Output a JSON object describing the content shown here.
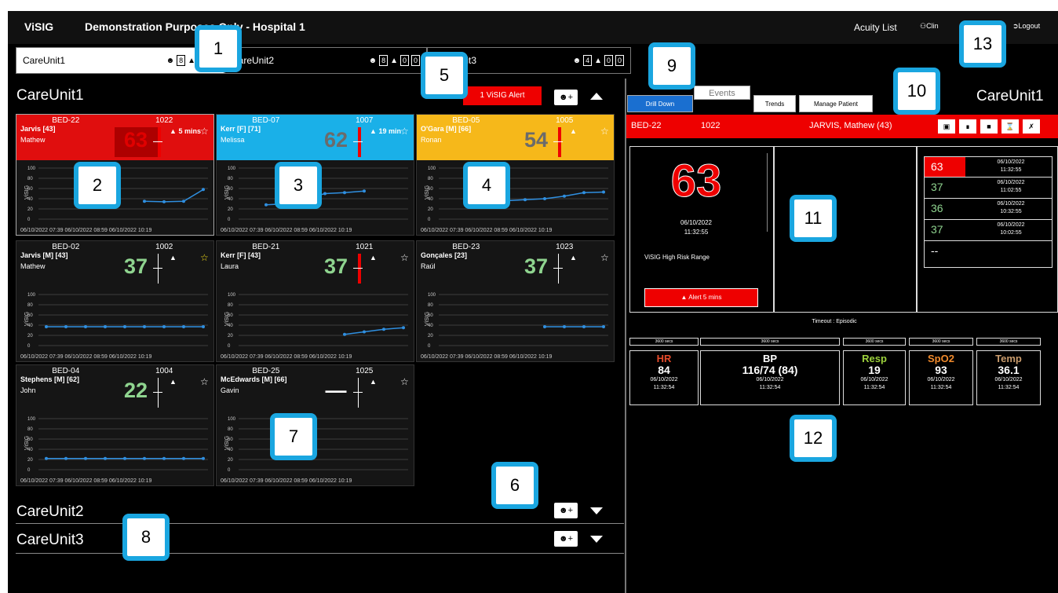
{
  "topbar": {
    "brand": "ViSIG",
    "title": "Demonstration Purposes Only - Hospital 1",
    "acuity_list": "Acuity List",
    "clinician": "Clin",
    "logout": "Logout"
  },
  "unit_tabs": [
    {
      "name": "CareUnit1",
      "patients": "8",
      "alerts": "1",
      "extra": "1"
    },
    {
      "name": "CareUnit2",
      "patients": "8",
      "alerts": "0",
      "extra": "0"
    },
    {
      "name": "CareUnit3",
      "patients": "4",
      "alerts": "0",
      "extra": "0"
    }
  ],
  "unit1": {
    "title": "CareUnit1",
    "alert_button": "1 ViSIG Alert"
  },
  "unit2": {
    "title": "CareUnit2"
  },
  "unit3": {
    "title": "CareUnit3"
  },
  "beds": [
    {
      "bed": "BED-22",
      "num": "1022",
      "name": "Jarvis [43]",
      "first": "Mathew",
      "score": "63",
      "info": "5 mins",
      "header_color": "#e00e0e",
      "score_color": "#e00000",
      "bar": "#e00",
      "values": [
        null,
        null,
        null,
        null,
        null,
        35,
        34,
        35,
        58
      ],
      "footer": "06/10/2022 07:39 06/10/2022 08:59 06/10/2022 10:19"
    },
    {
      "bed": "BED-07",
      "num": "1007",
      "name": "Kerr [F] [71]",
      "first": "Melissa",
      "score": "62",
      "info": "19 min",
      "header_color": "#1ab0e8",
      "score_color": "#6b6b6b",
      "bar": "#e00",
      "values": [
        null,
        28,
        30,
        40,
        50,
        52,
        55
      ],
      "footer": "06/10/2022 07:39 06/10/2022 08:59 06/10/2022 10:19"
    },
    {
      "bed": "BED-05",
      "num": "1005",
      "name": "O'Gara [M] [66]",
      "first": "Ronan",
      "score": "54",
      "info": "",
      "header_color": "#f6b81a",
      "score_color": "#6b6b6b",
      "bar": "#e00",
      "values": [
        null,
        30,
        34,
        36,
        38,
        40,
        45,
        52,
        53
      ],
      "footer": "06/10/2022 07:39 06/10/2022 08:59 06/10/2022 10:19"
    },
    {
      "bed": "BED-02",
      "num": "1002",
      "name": "Jarvis [M] [43]",
      "first": "Mathew",
      "score": "37",
      "info": "",
      "header_color": "",
      "score_color": "#8fd48f",
      "bar": "",
      "values": [
        37,
        37,
        37,
        37,
        37,
        37,
        37,
        37,
        37
      ],
      "footer": "06/10/2022 07:39 06/10/2022 08:59 06/10/2022 10:19"
    },
    {
      "bed": "BED-21",
      "num": "1021",
      "name": "Kerr [F] [43]",
      "first": "Laura",
      "score": "37",
      "info": "",
      "header_color": "",
      "score_color": "#8fd48f",
      "bar": "#e00",
      "values": [
        null,
        null,
        null,
        null,
        null,
        22,
        27,
        32,
        35
      ],
      "footer": "06/10/2022 07:39 06/10/2022 08:59 06/10/2022 10:19"
    },
    {
      "bed": "BED-23",
      "num": "1023",
      "name": "Gonçales [23]",
      "first": "Raúl",
      "score": "37",
      "info": "",
      "header_color": "",
      "score_color": "#8fd48f",
      "bar": "",
      "values": [
        null,
        null,
        null,
        null,
        null,
        37,
        37,
        37,
        37
      ],
      "footer": "06/10/2022 07:39 06/10/2022 08:59 06/10/2022 10:19"
    },
    {
      "bed": "BED-04",
      "num": "1004",
      "name": "Stephens [M] [62]",
      "first": "John",
      "score": "22",
      "info": "",
      "header_color": "",
      "score_color": "#8fd48f",
      "bar": "",
      "values": [
        22,
        22,
        22,
        22,
        22,
        22,
        22,
        22,
        22
      ],
      "footer": "06/10/2022 07:39 06/10/2022 08:59 06/10/2022 10:19"
    },
    {
      "bed": "BED-25",
      "num": "1025",
      "name": "McEdwards [M] [66]",
      "first": "Gavin",
      "score": "—",
      "info": "",
      "header_color": "",
      "score_color": "#ffffff",
      "bar": "",
      "values": [],
      "footer": "06/10/2022 07:39 06/10/2022 08:59 06/10/2022 10:19"
    }
  ],
  "right_tabs": [
    "Drill Down",
    "Events",
    "Trends",
    "Manage Patient"
  ],
  "right_unit_title": "CareUnit1",
  "selected": {
    "bed": "BED-22",
    "num": "1022",
    "name": "JARVIS, Mathew (43)"
  },
  "big_score": {
    "value": "63",
    "date": "06/10/2022",
    "time": "11:32:55",
    "range": "ViSIG High Risk Range",
    "alert": "Alert 5 mins"
  },
  "history": [
    {
      "value": "63",
      "date": "06/10/2022",
      "time": "11:32:55",
      "color": "#e00"
    },
    {
      "value": "37",
      "date": "06/10/2022",
      "time": "11:02:55",
      "color": "#8fd48f"
    },
    {
      "value": "36",
      "date": "06/10/2022",
      "time": "10:32:55",
      "color": "#8fd48f"
    },
    {
      "value": "37",
      "date": "06/10/2022",
      "time": "10:02:55",
      "color": "#8fd48f"
    },
    {
      "value": "--",
      "date": "",
      "time": "",
      "color": "#fff"
    }
  ],
  "timeout": "Timeout : Episodic",
  "secs": [
    "3600 secs",
    "3600 secs",
    "3600 secs",
    "3600 secs",
    "3600 secs"
  ],
  "vitals": [
    {
      "label": "HR",
      "value": "84",
      "date": "06/10/2022",
      "time": "11:32:54",
      "color": "#e54a2a"
    },
    {
      "label": "BP",
      "value": "116/74 (84)",
      "date": "06/10/2022",
      "time": "11:32:54",
      "color": "#ffffff"
    },
    {
      "label": "Resp",
      "value": "19",
      "date": "06/10/2022",
      "time": "11:32:54",
      "color": "#9dd23c"
    },
    {
      "label": "SpO2",
      "value": "93",
      "date": "06/10/2022",
      "time": "11:32:54",
      "color": "#f08a2c"
    },
    {
      "label": "Temp",
      "value": "36.1",
      "date": "06/10/2022",
      "time": "11:32:54",
      "color": "#c99b6c"
    }
  ],
  "chart_axis": {
    "ylabel": "ViSIG",
    "ticks": [
      "100",
      "80",
      "60",
      "40",
      "20",
      "0"
    ],
    "ylim": [
      0,
      100
    ]
  },
  "badges": [
    "1",
    "2",
    "3",
    "4",
    "5",
    "6",
    "7",
    "8",
    "9",
    "10",
    "11",
    "12",
    "13"
  ]
}
